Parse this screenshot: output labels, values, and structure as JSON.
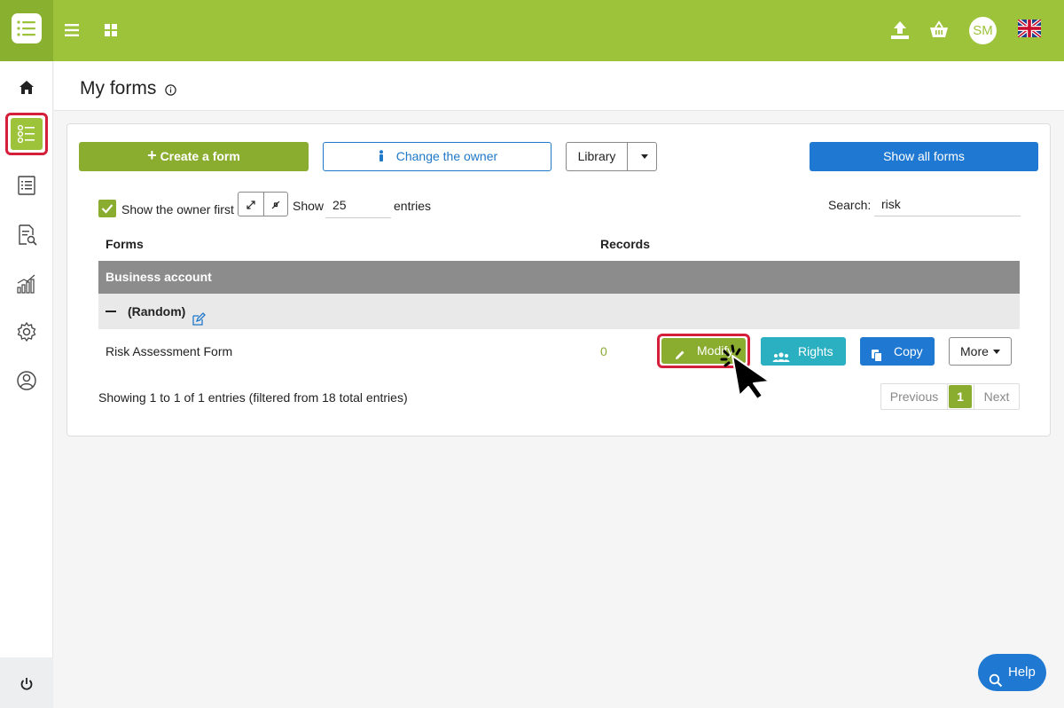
{
  "topbar": {
    "menu_icon": "hamburger-icon",
    "apps_icon": "grid-icon",
    "upload_icon": "upload-icon",
    "basket_icon": "basket-icon",
    "avatar_initials": "SM",
    "language_icon": "uk-flag-icon",
    "brand_color": "#9dc33b"
  },
  "sidebar": {
    "items": [
      {
        "icon": "home-icon"
      },
      {
        "icon": "forms-list-icon",
        "active": true
      },
      {
        "icon": "list-icon"
      },
      {
        "icon": "document-search-icon"
      },
      {
        "icon": "stats-icon"
      },
      {
        "icon": "gear-icon"
      },
      {
        "icon": "user-circle-icon"
      }
    ],
    "bottom_icon": "power-icon"
  },
  "page": {
    "title": "My forms"
  },
  "toolbar": {
    "create_label": "Create a form",
    "owner_label": "Change the owner",
    "library_label": "Library",
    "show_all_label": "Show all forms"
  },
  "filters": {
    "show_owner_first_label": "Show the owner first",
    "show_owner_first_checked": true,
    "show_label": "Show",
    "entries_value": "25",
    "entries_label": "entries",
    "search_label": "Search:",
    "search_value": "risk"
  },
  "table": {
    "columns": [
      "Forms",
      "Records"
    ],
    "group_label": "Business account",
    "subgroup_label": "(Random)",
    "rows": [
      {
        "form_name": "Risk Assessment Form",
        "records": "0",
        "modify_label": "Modify",
        "rights_label": "Rights",
        "copy_label": "Copy",
        "more_label": "More"
      }
    ]
  },
  "footer": {
    "summary": "Showing 1 to 1 of 1 entries (filtered from 18 total entries)",
    "previous_label": "Previous",
    "current_page": "1",
    "next_label": "Next"
  },
  "help": {
    "label": "Help"
  },
  "colors": {
    "accent_green": "#8aac2f",
    "accent_blue": "#1f78d1",
    "accent_teal": "#2bb0c2",
    "highlight_red": "#d41e3a"
  }
}
